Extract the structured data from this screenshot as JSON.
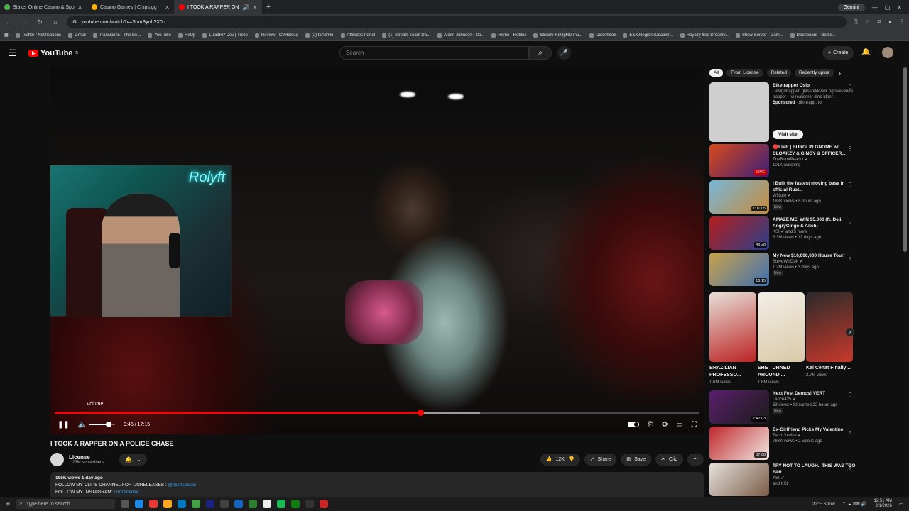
{
  "browser": {
    "tabs": [
      {
        "title": "Stake: Online Casino & Sports B..."
      },
      {
        "title": "Casino Games | Chips.gg"
      },
      {
        "title": "I TOOK A RAPPER ON A PO..."
      }
    ],
    "gemini_label": "Gemini",
    "url": "youtube.com/watch?v=SumSynh3X0o",
    "bookmarks": [
      "Twitter / Notifications",
      "Gmail",
      "Transitions - The Be...",
      "YouTube",
      "ReUp",
      "LucidRP Dev | Trello",
      "Review - CVHcloud",
      "(2) txAdmin",
      "Affiliates Panel",
      "(1) Stream Team Da...",
      "Aiden Johnson | No...",
      "Home - Roblox",
      "Stream ReUpHD mu...",
      "Discohook",
      "ESX.RegisterUsableI...",
      "Royalty free Dreamy...",
      "Show Server - Gam...",
      "Dashboard - Battle..."
    ]
  },
  "masthead": {
    "logo_text": "YouTube",
    "logo_region": "IN",
    "search_placeholder": "Search",
    "create_label": "Create"
  },
  "player": {
    "volume_tooltip": "Volume",
    "time_display": "9:45 / 17:15",
    "progress": 0.567,
    "buffered": 0.66,
    "volume": 0.75,
    "webcam_neon": "Rolyft"
  },
  "video": {
    "title": "I TOOK A RAPPER ON A POLICE CHASE",
    "channel_name": "License",
    "subscribers": "1.23M subscribers",
    "likes": "12K",
    "share_label": "Share",
    "save_label": "Save",
    "clip_label": "Clip",
    "description_meta": "195K views  1 day ago",
    "description_line1": "FOLLOW MY CLIPS CHANNEL FOR UNRELEASES :",
    "description_link1": "@licenseclips",
    "description_line2": "FOLLOW MY INSTAGRAM:",
    "description_link2": "/ not.license"
  },
  "sidebar": {
    "chips": [
      "All",
      "From License",
      "Related",
      "Recently uploa"
    ],
    "ad": {
      "title": "Eiketrapper Oslo",
      "text": "Designtrapper, glassrekkverk og svevende trapper – vi realiserer dine ideer.",
      "sponsored": "Sponsored",
      "domain": "· din-trapp.no",
      "cta": "Visit site"
    },
    "recs": [
      {
        "title": "🔴LIVE | BURGLIN GNOME w/ CLOAKZY & GINGY & OFFICER...",
        "channel": "TheBurntPeanut",
        "meta": "101K watching",
        "badge": "LIVE",
        "new": "",
        "colors": [
          "#d94a1a",
          "#3b1e7a"
        ]
      },
      {
        "title": "I Built the fastest moving base in official Rust...",
        "channel": "Willjum",
        "meta": "183K views • 8 hours ago",
        "badge": "1:11:05",
        "new": "New",
        "colors": [
          "#77b7d9",
          "#c58a3a"
        ]
      },
      {
        "title": "AMAZE ME, WIN $5,000 (ft. Deji, AngryGinge & Aitch)",
        "channel": "KSI",
        "meta": "3.3M views • 12 days ago",
        "badge": "48:28",
        "new": "",
        "colors": [
          "#b51d1d",
          "#2a3f8a"
        ],
        "extra": "and 5 more"
      },
      {
        "title": "My New $10,000,000 House Tour!",
        "channel": "SteveWillDoIt",
        "meta": "1.2M views • 3 days ago",
        "badge": "16:15",
        "new": "New",
        "colors": [
          "#c9a24b",
          "#3f6fb0"
        ]
      }
    ],
    "shorts": [
      {
        "title": "BRAZILIAN PROFESSO...",
        "views": "1.6M views",
        "colors": [
          "#e8e0d8",
          "#b22"
        ]
      },
      {
        "title": "SHE TURNED AROUND ...",
        "views": "1.6M views",
        "colors": [
          "#f3efe6",
          "#d9c9a8"
        ]
      },
      {
        "title": "Kai Cenat Finally ...",
        "views": "2.7M views",
        "colors": [
          "#2a2a2a",
          "#c8392b"
        ]
      }
    ],
    "recs2": [
      {
        "title": "Next Fest Demos! VERT",
        "channel": "Lance425",
        "meta": "63 views • Streamed 22 hours ago",
        "badge": "2:42:03",
        "new": "New",
        "colors": [
          "#5a1f6b",
          "#1b1b1b"
        ]
      },
      {
        "title": "Ex-Girlfriend Picks My Valentine",
        "channel": "Zach Justice",
        "meta": "783K views • 2 weeks ago",
        "badge": "37:08",
        "new": "",
        "colors": [
          "#c0262d",
          "#f2e9e2"
        ]
      },
      {
        "title": "TRY NOT TO LAUGH.. THIS WAS TOO FAR",
        "channel": "KSI",
        "meta": "and KSI",
        "badge": "",
        "new": "",
        "colors": [
          "#e6e1dc",
          "#7b5c47"
        ]
      }
    ]
  },
  "taskbar": {
    "search_placeholder": "Type here to search",
    "weather": "22°F  Snow",
    "time": "12:51 AM",
    "date": "3/1/2026"
  }
}
